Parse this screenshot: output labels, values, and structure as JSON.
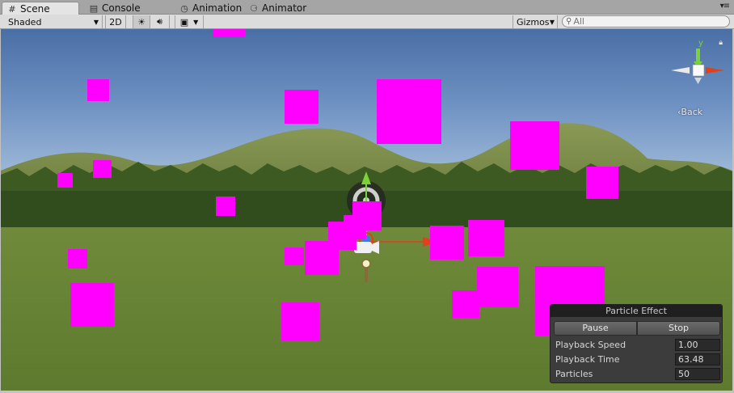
{
  "tabs": [
    {
      "label": "Scene",
      "icon": "grid-icon",
      "active": true
    },
    {
      "label": "Console",
      "icon": "console-icon",
      "active": false
    },
    {
      "label": "Animation",
      "icon": "animation-icon",
      "active": false
    },
    {
      "label": "Animator",
      "icon": "animator-icon",
      "active": false
    }
  ],
  "toolbar": {
    "draw_mode": "Shaded",
    "mode_2d": "2D",
    "lighting_icon": "sun-icon",
    "audio_icon": "speaker-icon",
    "effects_icon": "image-icon",
    "gizmos": "Gizmos",
    "search_placeholder": "All"
  },
  "scene_gizmo": {
    "back_label": "Back",
    "axis_label": "y"
  },
  "particle_panel": {
    "title": "Particle Effect",
    "pause_label": "Pause",
    "stop_label": "Stop",
    "rows": [
      {
        "label": "Playback Speed",
        "value": "1.00"
      },
      {
        "label": "Playback Time",
        "value": "63.48"
      },
      {
        "label": "Particles",
        "value": "50"
      }
    ]
  },
  "colors": {
    "particle": "#ff00ff",
    "axis_x": "#e0401a",
    "axis_y": "#7bd236",
    "axis_z": "#3b7be0"
  }
}
